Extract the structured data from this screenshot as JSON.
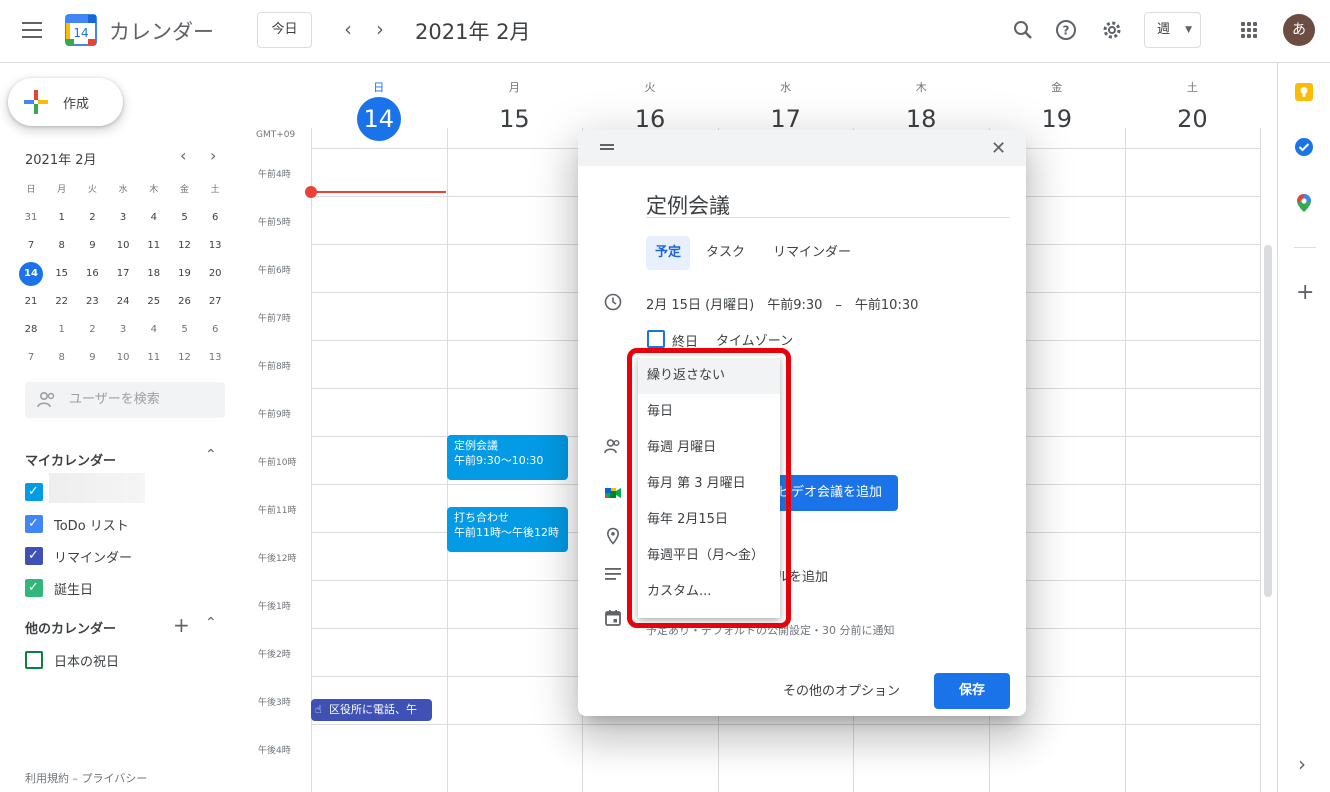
{
  "header": {
    "app_title": "カレンダー",
    "logo_day": "14",
    "today_label": "今日",
    "period": "2021年 2月",
    "view_label": "週",
    "avatar_initial": "あ"
  },
  "sidebar": {
    "create_label": "作成",
    "mini_title": "2021年 2月",
    "weekday_heads": [
      "日",
      "月",
      "火",
      "水",
      "木",
      "金",
      "土"
    ],
    "weeks": [
      [
        "31",
        "1",
        "2",
        "3",
        "4",
        "5",
        "6"
      ],
      [
        "7",
        "8",
        "9",
        "10",
        "11",
        "12",
        "13"
      ],
      [
        "14",
        "15",
        "16",
        "17",
        "18",
        "19",
        "20"
      ],
      [
        "21",
        "22",
        "23",
        "24",
        "25",
        "26",
        "27"
      ],
      [
        "28",
        "1",
        "2",
        "3",
        "4",
        "5",
        "6"
      ],
      [
        "7",
        "8",
        "9",
        "10",
        "11",
        "12",
        "13"
      ]
    ],
    "user_search_placeholder": "ユーザーを検索",
    "my_calendars_title": "マイカレンダー",
    "my_calendars": [
      {
        "label": "",
        "color": "#039be5"
      },
      {
        "label": "ToDo リスト",
        "color": "#4285f4"
      },
      {
        "label": "リマインダー",
        "color": "#3f51b5"
      },
      {
        "label": "誕生日",
        "color": "#33b679"
      }
    ],
    "other_calendars_title": "他のカレンダー",
    "other_calendars": [
      {
        "label": "日本の祝日",
        "color": "#0b8043"
      }
    ],
    "footer": "利用規約 – プライバシー"
  },
  "week": {
    "timezone": "GMT+09",
    "days": [
      {
        "name": "日",
        "num": "14"
      },
      {
        "name": "月",
        "num": "15"
      },
      {
        "name": "火",
        "num": "16"
      },
      {
        "name": "水",
        "num": "17"
      },
      {
        "name": "木",
        "num": "18"
      },
      {
        "name": "金",
        "num": "19"
      },
      {
        "name": "土",
        "num": "20"
      }
    ],
    "time_labels": [
      "午前4時",
      "午前5時",
      "午前6時",
      "午前7時",
      "午前8時",
      "午前9時",
      "午前10時",
      "午前11時",
      "午後12時",
      "午後1時",
      "午後2時",
      "午後3時",
      "午後4時"
    ],
    "events": [
      {
        "title": "定例会議",
        "time": "午前9:30～10:30",
        "color": "#039be5"
      },
      {
        "title": "打ち合わせ",
        "time": "午前11時～午後12時",
        "color": "#039be5"
      },
      {
        "title": "区役所に電話、午",
        "color": "#3f51b5"
      }
    ]
  },
  "dialog": {
    "title": "定例会議",
    "tabs": [
      "予定",
      "タスク",
      "リマインダー"
    ],
    "datetime": "2月 15日 (月曜日)　午前9:30　–　午前10:30",
    "allday_label": "終日",
    "timezone_label": "タイムゾーン",
    "meet_button": "ビデオ会議を追加",
    "description_hint": "説明または添付ファイルを追加",
    "calendar_hint": "予定あり・デフォルトの公開設定・30 分前に通知",
    "more_options": "その他のオプション",
    "save": "保存"
  },
  "recurrence_dropdown": {
    "options": [
      "繰り返さない",
      "毎日",
      "毎週 月曜日",
      "毎月 第 3 月曜日",
      "毎年 2月15日",
      "毎週平日（月～金）",
      "カスタム..."
    ],
    "selected": "繰り返さない"
  },
  "colors": {
    "accent": "#1a73e8",
    "highlight": "#e8000b",
    "now_line": "#ea4335"
  }
}
